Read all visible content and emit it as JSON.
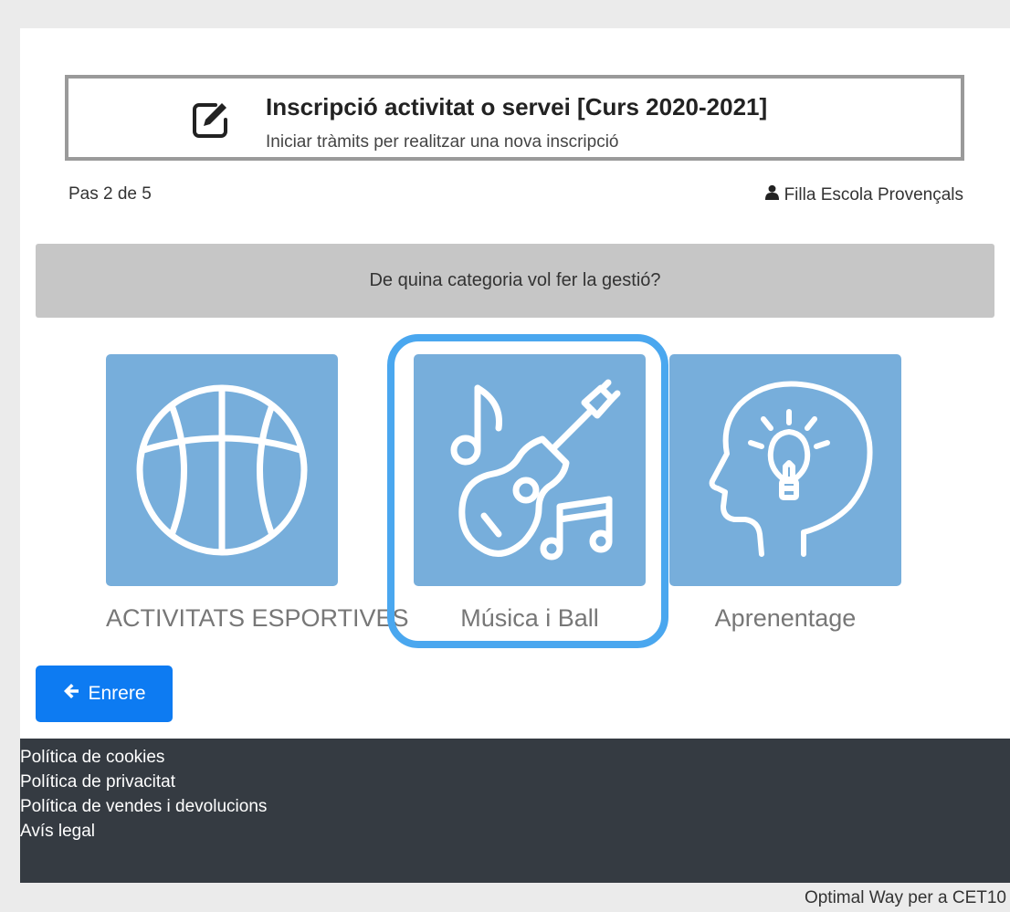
{
  "header": {
    "title": "Inscripció activitat o servei [Curs 2020-2021]",
    "subtitle": "Iniciar tràmits per realitzar una nova inscripció"
  },
  "step": {
    "text": "Pas 2 de 5"
  },
  "user": {
    "name": "Filla Escola Provençals",
    "icon": "user-icon"
  },
  "question": "De quina categoria vol fer la gestió?",
  "categories": [
    {
      "label": "ACTIVITATS ESPORTIVES",
      "icon": "basketball-icon"
    },
    {
      "label": "Música i Ball",
      "icon": "guitar-music-icon",
      "selected": true
    },
    {
      "label": "Aprenentage",
      "icon": "head-lightbulb-icon"
    }
  ],
  "back_button": {
    "label": "Enrere",
    "icon": "arrow-left-icon"
  },
  "footer": {
    "links": [
      "Política de cookies",
      "Política de privacitat",
      "Política de vendes i devolucions",
      "Avís legal"
    ]
  },
  "credit": "Optimal Way per a CET10",
  "colors": {
    "tile": "#77aedb",
    "highlight": "#4aa7ef",
    "primary_button": "#0d7bf2",
    "footer_bg": "#353b42",
    "question_bg": "#c6c6c6"
  }
}
